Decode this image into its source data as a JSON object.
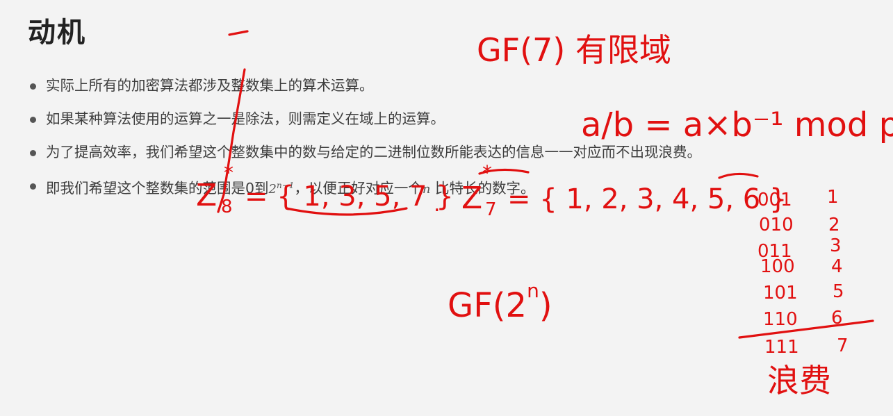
{
  "slide": {
    "title": "动机",
    "bullets": [
      "实际上所有的加密算法都涉及整数集上的算术运算。",
      "如果某种算法使用的运算之一是除法，则需定义在域上的运算。",
      "为了提高效率，我们希望这个整数集中的数与给定的二进制位数所能表达的信息一一对应而不出现浪费。"
    ],
    "last_bullet": {
      "prefix": "即我们希望这个整数集的范围是0到",
      "power_base": "2",
      "power_exp": "n−1",
      "middle": "，以便正好对应一个",
      "var": "n",
      "suffix": " 比特长的数字。"
    }
  },
  "annotations": {
    "color": "#e11010",
    "gf7": "GF(7) 有限域",
    "division": "a/b = a×b⁻¹ mod p",
    "z8_label": "Z",
    "z8_sub": "8",
    "z8_sup": "*",
    "z8_set": "= { 1, 3, 5, 7 }",
    "z7_label": "Z",
    "z7_sub": "7",
    "z7_sup": "*",
    "z7_set": "= { 1, 2, 3, 4, 5, 6 }",
    "gf2n_base": "GF(2",
    "gf2n_exp": "n",
    "gf2n_close": ")",
    "binary_table": [
      [
        "001",
        "1"
      ],
      [
        "010",
        "2"
      ],
      [
        "011",
        "3"
      ],
      [
        "100",
        "4"
      ],
      [
        "101",
        "5"
      ],
      [
        "110",
        "6"
      ],
      [
        "111",
        "7"
      ]
    ],
    "waste": "浪费"
  }
}
